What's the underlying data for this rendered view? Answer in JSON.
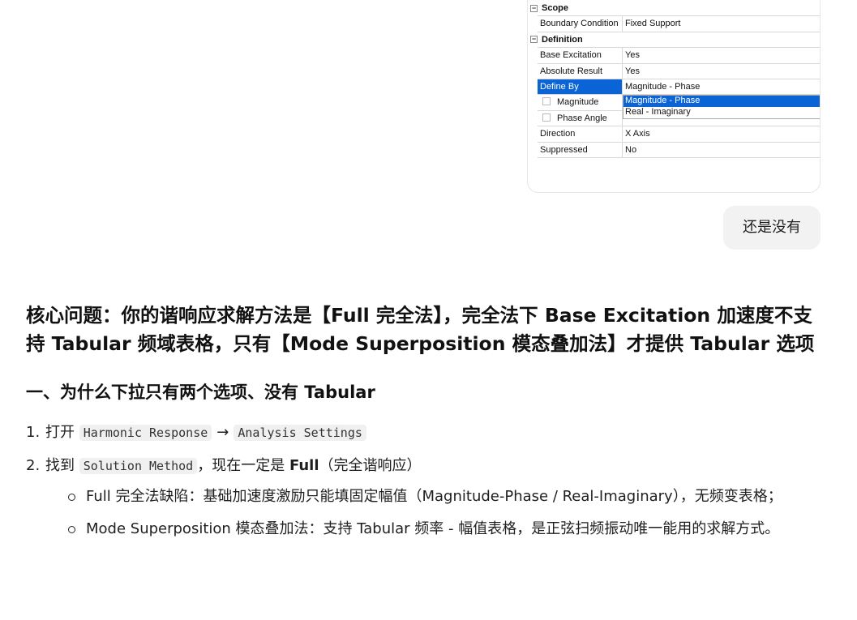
{
  "screenshot": {
    "rows": [
      {
        "type": "section",
        "label": "Scope"
      },
      {
        "type": "row",
        "label": "Boundary Condition",
        "value": "Fixed Support"
      },
      {
        "type": "section",
        "label": "Definition"
      },
      {
        "type": "row",
        "label": "Base Excitation",
        "value": "Yes"
      },
      {
        "type": "row",
        "label": "Absolute Result",
        "value": "Yes"
      },
      {
        "type": "row",
        "label": "Define By",
        "value": "Magnitude - Phase",
        "selected": true
      },
      {
        "type": "check",
        "label": "Magnitude",
        "value": ""
      },
      {
        "type": "check",
        "label": "Phase Angle",
        "value": ""
      },
      {
        "type": "row",
        "label": "Direction",
        "value": "X Axis"
      },
      {
        "type": "row",
        "label": "Suppressed",
        "value": "No"
      }
    ],
    "dropdown_options": [
      "Magnitude - Phase",
      "Real - Imaginary"
    ],
    "selection_color": "#0a64d6"
  },
  "user_message": "还是没有",
  "answer": {
    "heading": "核心问题：你的谐响应求解方法是【Full 完全法】，完全法下 Base Excitation 加速度不支持 Tabular 频域表格，只有【Mode Superposition 模态叠加法】才提供 Tabular 选项",
    "section_title": "一、为什么下拉只有两个选项、没有 Tabular",
    "step1": {
      "num": "1.",
      "prefix": "打开",
      "code1": "Harmonic Response",
      "arrow": "→",
      "code2": "Analysis Settings"
    },
    "step2": {
      "num": "2.",
      "prefix": "找到",
      "code": "Solution Method",
      "middle": "，现在一定是",
      "strong": "Full",
      "suffix": "（完全谐响应）"
    },
    "bullets": [
      "Full 完全法缺陷：基础加速度激励只能填固定幅值（Magnitude-Phase / Real-Imaginary），无频变表格；",
      "Mode Superposition 模态叠加法：支持 Tabular 频率 - 幅值表格，是正弦扫频振动唯一能用的求解方式。"
    ]
  }
}
